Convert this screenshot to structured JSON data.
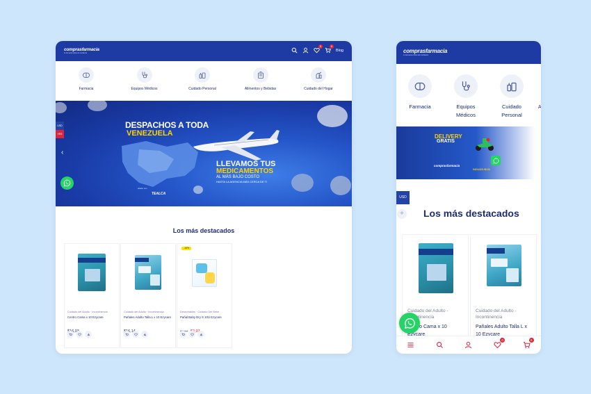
{
  "brand": {
    "logo_primary": "comprasfarmacia",
    "logo_secondary": "tu farmacia online de confianza"
  },
  "desktop": {
    "header": {
      "icons": [
        "search-icon",
        "user-icon",
        "heart-icon",
        "cart-icon"
      ],
      "wishlist_count": "0",
      "cart_count": "0",
      "blog_label": "Blog"
    },
    "categories": [
      {
        "label": "Farmacia",
        "icon": "pharmacy-icon"
      },
      {
        "label": "Equipos Médicos",
        "icon": "stethoscope-icon"
      },
      {
        "label": "Cuidado Personal",
        "icon": "personal-care-icon"
      },
      {
        "label": "Alimentos y Bebidas",
        "icon": "food-icon"
      },
      {
        "label": "Cuidado del Hogar",
        "icon": "home-care-icon"
      }
    ],
    "banner": {
      "line1": "DESPACHOS A TODA",
      "line2": "VENEZUELA",
      "line3": "LLEVAMOS TUS",
      "line4": "MEDICAMENTOS",
      "line5": "AL MÁS BAJO COSTO",
      "line6": "HASTA LA AGENCIA MÁS CERCA DE TI",
      "partner_small": "aliado con",
      "partner": "TEALCA",
      "currency_usd": "USD",
      "currency_ves": "VES"
    },
    "section_title": "Los más destacados",
    "products": [
      {
        "category": "Cuidado del Adulto · Incontinencia",
        "name": "Centro Cama x 10 Ezycare",
        "price": "$16,03",
        "old_price": "",
        "badge": ""
      },
      {
        "category": "Cuidado del Adulto · Incontinencia",
        "name": "Pañales Adulto Talla L x 10 Ezycare",
        "price": "$16,14",
        "old_price": "",
        "badge": ""
      },
      {
        "category": "Desechables · Cuidado Del Bebe",
        "name": "Pañal Baby Dry S 10U Ezycare",
        "price": "$2,97",
        "old_price": "$3,54",
        "badge": "-16%"
      }
    ]
  },
  "mobile": {
    "categories": [
      {
        "label": "Farmacia",
        "icon": "pharmacy-icon"
      },
      {
        "label": "Equipos Médicos",
        "icon": "stethoscope-icon"
      },
      {
        "label": "Cuidado Personal",
        "icon": "personal-care-icon"
      }
    ],
    "next_category_initial": "A",
    "banner": {
      "line1": "DELIVERY",
      "line2": "GRATIS",
      "logo": "comprasfarmacia",
      "phone": "0424•323.98.03"
    },
    "currency_usd": "USD",
    "plus": "+",
    "section_title": "Los más destacados",
    "products": [
      {
        "category": "Cuidado del Adulto - Incontinencia",
        "name": "Centro Cama x 10 Ezycare"
      },
      {
        "category": "Cuidado del Adulto - Incontinencia",
        "name": "Pañales Adulto Talla L x 10 Ezycare"
      }
    ],
    "bottom_nav": {
      "icons": [
        "menu-icon",
        "search-icon",
        "user-icon",
        "heart-icon",
        "cart-icon"
      ],
      "wishlist_count": "0",
      "cart_count": "0"
    }
  },
  "colors": {
    "background": "#cde6fb",
    "header_blue": "#1e3aa3",
    "title_navy": "#1e2c74",
    "sale_red": "#e0283a",
    "whatsapp_green": "#25d366",
    "banner_yellow": "#ffd200"
  }
}
